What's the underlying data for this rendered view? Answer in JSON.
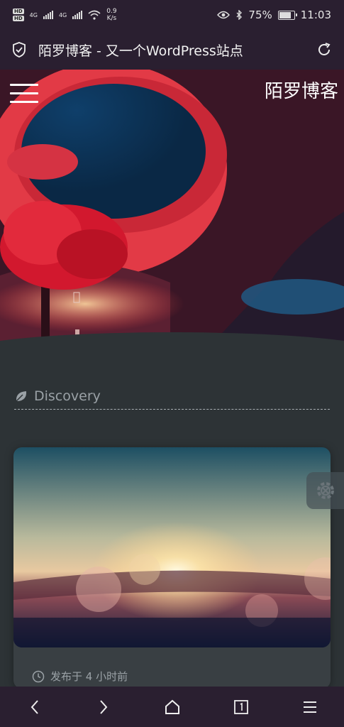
{
  "status_bar": {
    "sim1": "HD",
    "sim2": "HD",
    "net1": "4G",
    "net2": "4G",
    "speed_value": "0.9",
    "speed_unit": "K/s",
    "battery": "75%",
    "time": "11:03"
  },
  "browser": {
    "page_title": "陌罗博客 - 又一个WordPress站点"
  },
  "hero": {
    "site_name": "陌罗博客"
  },
  "section": {
    "label": "Discovery"
  },
  "post": {
    "meta_label": "发布于 4 小时前"
  },
  "colors": {
    "bar_bg": "#2a1f30",
    "page_bg": "#2d3336",
    "card_bg": "#393f43"
  }
}
